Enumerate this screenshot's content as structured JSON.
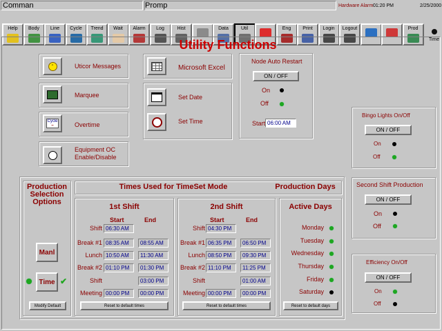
{
  "topbar": {
    "command_label": "Comman",
    "prompt_label": "Promp",
    "status": "Hardware Alarm",
    "time": "01:20 PM",
    "date": "2/25/2000"
  },
  "toolbar": {
    "items": [
      {
        "label": "Help",
        "icon": "question-icon"
      },
      {
        "label": "Body",
        "icon": "globe-icon"
      },
      {
        "label": "Line",
        "icon": "line-icon"
      },
      {
        "label": "Cycle",
        "icon": "cycle-icon"
      },
      {
        "label": "Trend",
        "icon": "trend-icon"
      },
      {
        "label": "Wait",
        "icon": "hand-icon"
      },
      {
        "label": "Alarm",
        "icon": "alarm-icon"
      },
      {
        "label": "Log",
        "icon": "log-icon"
      },
      {
        "label": "Hist",
        "icon": "history-icon"
      },
      {
        "label": "",
        "icon": "refresh-icon"
      },
      {
        "label": "Data",
        "icon": "data-icon"
      },
      {
        "label": "Util",
        "icon": "utility-icon"
      },
      {
        "label": "",
        "icon": "warning-icon"
      },
      {
        "label": "Eng",
        "icon": "engine-icon"
      },
      {
        "label": "Print",
        "icon": "print-icon"
      },
      {
        "label": "Login",
        "icon": "key-icon"
      },
      {
        "label": "Logout",
        "icon": "logout-key-icon"
      },
      {
        "label": "",
        "icon": "earth-icon"
      },
      {
        "label": "",
        "icon": "shutdown-icon"
      },
      {
        "label": "Prod",
        "icon": "production-icon"
      },
      {
        "label": "Time",
        "icon": "time-icon"
      }
    ]
  },
  "page_title": "Utility Functions",
  "utility": {
    "messages": "Uticor Messages",
    "marquee": "Marquee",
    "overtime": "Overtime",
    "equipment": "Equipment OC Enable/Disable",
    "excel": "Microsoft Excel",
    "set_date": "Set Date",
    "set_time": "Set Time"
  },
  "node_restart": {
    "title": "Node Auto Restart",
    "toggle": "ON / OFF",
    "on": "On",
    "off": "Off",
    "start_label": "Start",
    "start_value": "06:00 AM"
  },
  "bingo": {
    "title": "Bingo Lights On/Off",
    "toggle": "ON / OFF",
    "on": "On",
    "off": "Off"
  },
  "second_shift": {
    "title": "Second Shift Production",
    "toggle": "ON / OFF",
    "on": "On",
    "off": "Off"
  },
  "efficiency": {
    "title": "Efficiency On/Off",
    "toggle": "ON / OFF",
    "on": "On",
    "off": "Off"
  },
  "production": {
    "title": "Production Selection Options",
    "manual": "Manl",
    "time": "Time",
    "modify": "Modify Default"
  },
  "times": {
    "title": "Times Used for TimeSet Mode",
    "start": "Start",
    "end": "End",
    "reset": "Reset to default times",
    "shift1": {
      "title": "1st Shift",
      "rows": [
        {
          "label": "Shift",
          "start": "06:30 AM",
          "end": ""
        },
        {
          "label": "Break #1",
          "start": "08:35 AM",
          "end": "08:55 AM"
        },
        {
          "label": "Lunch",
          "start": "10:50 AM",
          "end": "11:30 AM"
        },
        {
          "label": "Break #2",
          "start": "01:10 PM",
          "end": "01:30 PM"
        },
        {
          "label": "Shift",
          "start": "",
          "end": "03:00 PM"
        },
        {
          "label": "Meeting",
          "start": "00:00 PM",
          "end": "00:00 PM"
        }
      ]
    },
    "shift2": {
      "title": "2nd Shift",
      "rows": [
        {
          "label": "Shift",
          "start": "04:30 PM",
          "end": ""
        },
        {
          "label": "Break #1",
          "start": "06:35 PM",
          "end": "06:50 PM"
        },
        {
          "label": "Lunch",
          "start": "08:50 PM",
          "end": "09:30 PM"
        },
        {
          "label": "Break #2",
          "start": "11:10 PM",
          "end": "11:25 PM"
        },
        {
          "label": "Shift",
          "start": "",
          "end": "01:00 AM"
        },
        {
          "label": "Meeting",
          "start": "00:00 PM",
          "end": "00:00 PM"
        }
      ]
    }
  },
  "days": {
    "title": "Production Days",
    "subtitle": "Active Days",
    "reset": "Reset to default days",
    "items": [
      {
        "day": "Monday",
        "state": "on"
      },
      {
        "day": "Tuesday",
        "state": "on"
      },
      {
        "day": "Wednesday",
        "state": "on"
      },
      {
        "day": "Thursday",
        "state": "on"
      },
      {
        "day": "Friday",
        "state": "on"
      },
      {
        "day": "Saturday",
        "state": "off"
      }
    ]
  },
  "colors": {
    "title": "#cc0000",
    "label": "#8b0000",
    "on": "#1fa61f",
    "off": "#000000",
    "field_text": "#00008b"
  }
}
